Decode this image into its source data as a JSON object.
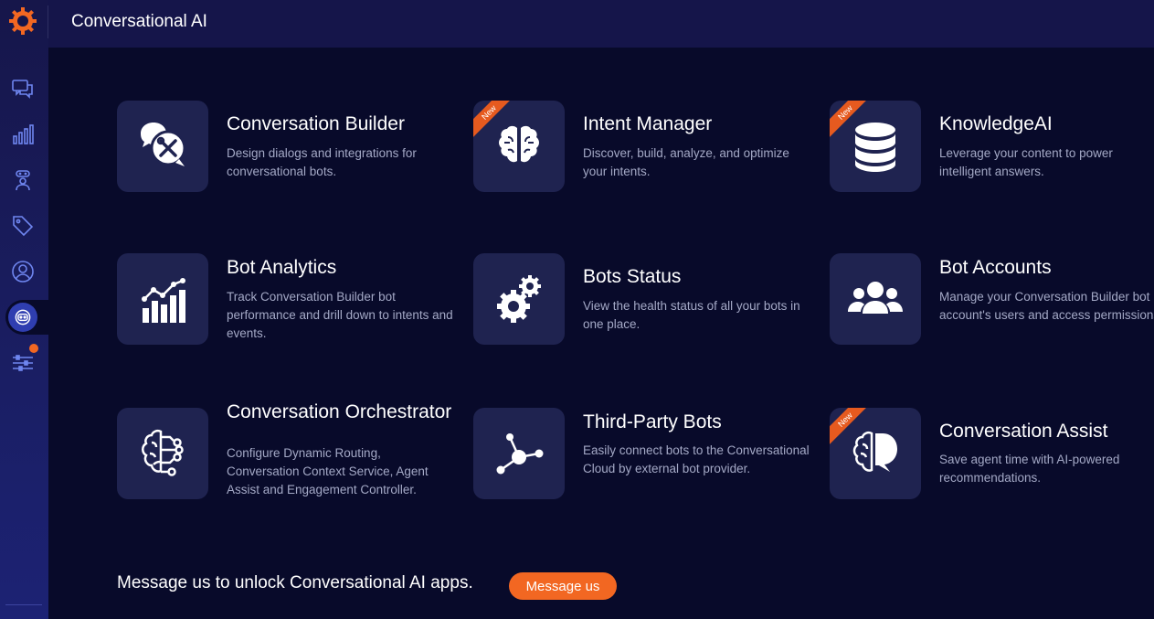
{
  "header": {
    "title": "Conversational AI"
  },
  "sidebar": {
    "items": [
      {
        "name": "conversations",
        "icon": "chat-bubbles-icon"
      },
      {
        "name": "analytics",
        "icon": "bar-chart-icon"
      },
      {
        "name": "agents",
        "icon": "agent-icon"
      },
      {
        "name": "tags",
        "icon": "tag-icon"
      },
      {
        "name": "profile",
        "icon": "user-circle-icon"
      },
      {
        "name": "conversational-ai",
        "icon": "bot-icon",
        "active": true
      },
      {
        "name": "settings",
        "icon": "sliders-icon",
        "badge": true
      }
    ]
  },
  "apps": [
    {
      "name": "Conversation Builder",
      "desc": "Design dialogs and integrations for conversational bots.",
      "icon": "chat-tools-icon",
      "new": false
    },
    {
      "name": "Intent Manager",
      "desc": "Discover, build, analyze, and optimize your intents.",
      "icon": "brain-icon",
      "new": true
    },
    {
      "name": "KnowledgeAI",
      "desc": "Leverage your content to power intelligent answers.",
      "icon": "database-icon",
      "new": true
    },
    {
      "name": "Bot Analytics",
      "desc": "Track Conversation Builder bot performance and drill down to intents and events.",
      "icon": "analytics-chart-icon",
      "new": false
    },
    {
      "name": "Bots Status",
      "desc": "View the health status of all your bots in one place.",
      "icon": "gears-icon",
      "new": false
    },
    {
      "name": "Bot Accounts",
      "desc": "Manage your Conversation Builder bot account's users and access permissions.",
      "icon": "users-group-icon",
      "new": false
    },
    {
      "name": "Conversation Orchestrator",
      "desc": "Configure Dynamic Routing, Conversation Context Service, Agent Assist and Engagement Controller.",
      "icon": "brain-circuit-icon",
      "new": false
    },
    {
      "name": "Third-Party Bots",
      "desc": "Easily connect bots to the Conversational Cloud by external bot provider.",
      "icon": "network-nodes-icon",
      "new": false
    },
    {
      "name": "Conversation Assist",
      "desc": "Save agent time with AI-powered recommendations.",
      "icon": "brain-chat-icon",
      "new": true
    }
  ],
  "ribbon_label": "New",
  "cta": {
    "text": "Message us to unlock Conversational AI apps.",
    "button": "Message us"
  },
  "colors": {
    "accent": "#f26722",
    "background": "#080a2a",
    "tile": "#1f2350"
  }
}
